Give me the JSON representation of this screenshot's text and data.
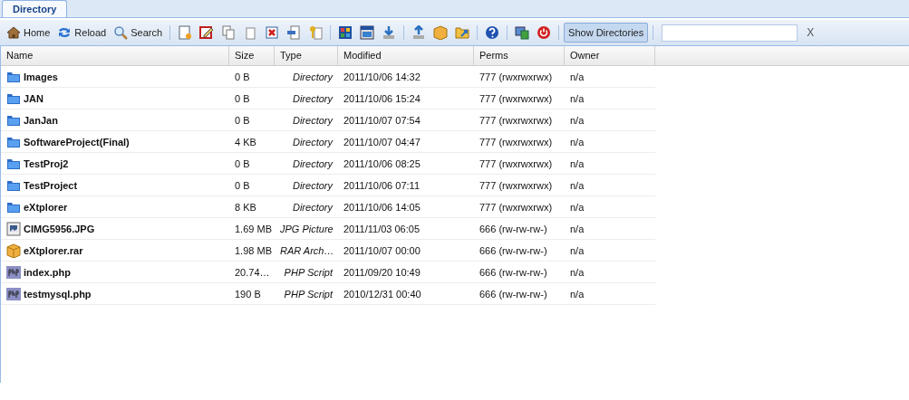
{
  "tabs": [
    {
      "label": "Directory",
      "selected": true
    }
  ],
  "toolbar": {
    "buttons": [
      {
        "kind": "home",
        "label": "Home"
      },
      {
        "kind": "reload",
        "label": "Reload"
      },
      {
        "kind": "search",
        "label": "Search"
      }
    ],
    "toggle": {
      "label": "Show Directories",
      "pressed": true
    },
    "filter": {
      "clear": "X"
    }
  },
  "table": {
    "columns": [
      "Name",
      "Size",
      "Type",
      "Modified",
      "Perms",
      "Owner"
    ],
    "rows": [
      {
        "kind": "folder",
        "name": "Images",
        "size": "0 B",
        "type": "Directory",
        "modified": "2011/10/06 14:32",
        "perms": "777 (rwxrwxrwx)",
        "owner": "n/a"
      },
      {
        "kind": "folder",
        "name": "JAN",
        "size": "0 B",
        "type": "Directory",
        "modified": "2011/10/06 15:24",
        "perms": "777 (rwxrwxrwx)",
        "owner": "n/a"
      },
      {
        "kind": "folder",
        "name": "JanJan",
        "size": "0 B",
        "type": "Directory",
        "modified": "2011/10/07 07:54",
        "perms": "777 (rwxrwxrwx)",
        "owner": "n/a"
      },
      {
        "kind": "folder",
        "name": "SoftwareProject(Final)",
        "size": "4 KB",
        "type": "Directory",
        "modified": "2011/10/07 04:47",
        "perms": "777 (rwxrwxrwx)",
        "owner": "n/a"
      },
      {
        "kind": "folder",
        "name": "TestProj2",
        "size": "0 B",
        "type": "Directory",
        "modified": "2011/10/06 08:25",
        "perms": "777 (rwxrwxrwx)",
        "owner": "n/a"
      },
      {
        "kind": "folder",
        "name": "TestProject",
        "size": "0 B",
        "type": "Directory",
        "modified": "2011/10/06 07:11",
        "perms": "777 (rwxrwxrwx)",
        "owner": "n/a"
      },
      {
        "kind": "folder",
        "name": "eXtplorer",
        "size": "8 KB",
        "type": "Directory",
        "modified": "2011/10/06 14:05",
        "perms": "777 (rwxrwxrwx)",
        "owner": "n/a"
      },
      {
        "kind": "image",
        "name": "CIMG5956.JPG",
        "size": "1.69 MB",
        "type": "JPG Picture",
        "modified": "2011/11/03 06:05",
        "perms": "666 (rw-rw-rw-)",
        "owner": "n/a"
      },
      {
        "kind": "archive",
        "name": "eXtplorer.rar",
        "size": "1.98 MB",
        "type": "RAR Arch…",
        "modified": "2011/10/07 00:00",
        "perms": "666 (rw-rw-rw-)",
        "owner": "n/a"
      },
      {
        "kind": "php",
        "name": "index.php",
        "size": "20.74…",
        "type": "PHP Script",
        "modified": "2011/09/20 10:49",
        "perms": "666 (rw-rw-rw-)",
        "owner": "n/a"
      },
      {
        "kind": "php",
        "name": "testmysql.php",
        "size": "190 B",
        "type": "PHP Script",
        "modified": "2010/12/31 00:40",
        "perms": "666 (rw-rw-rw-)",
        "owner": "n/a"
      }
    ]
  }
}
